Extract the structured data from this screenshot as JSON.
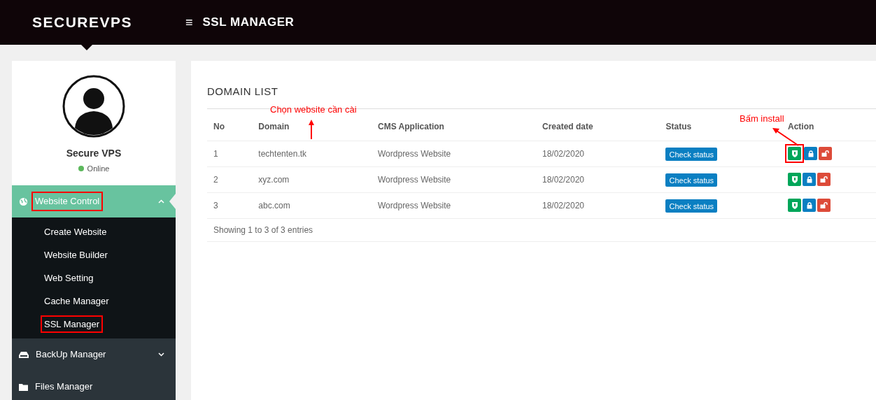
{
  "header": {
    "logo": "SECUREVPS",
    "menu_icon": "≡",
    "title": "SSL MANAGER"
  },
  "profile": {
    "name": "Secure VPS",
    "status": "Online",
    "online": true
  },
  "sidebar": {
    "items": [
      {
        "label": "Website Control",
        "expanded": true,
        "selected": true,
        "highlighted": true,
        "children": [
          {
            "label": "Create Website",
            "highlighted": false
          },
          {
            "label": "Website Builder",
            "highlighted": false
          },
          {
            "label": "Web Setting",
            "highlighted": false
          },
          {
            "label": "Cache Manager",
            "highlighted": false
          },
          {
            "label": "SSL Manager",
            "highlighted": true
          }
        ]
      },
      {
        "label": "BackUp Manager",
        "expanded": false,
        "selected": false,
        "highlighted": false
      },
      {
        "label": "Files Manager",
        "selected": false,
        "highlighted": false
      }
    ]
  },
  "panel": {
    "title": "DOMAIN LIST",
    "table": {
      "columns": [
        "No",
        "Domain",
        "CMS Application",
        "Created date",
        "Status",
        "Action"
      ],
      "rows": [
        {
          "no": "1",
          "domain": "techtenten.tk",
          "cms": "Wordpress Website",
          "created": "18/02/2020",
          "status": "Check status",
          "actions": [
            {
              "kind": "install",
              "highlighted": true
            },
            {
              "kind": "lock",
              "highlighted": false
            },
            {
              "kind": "unlock",
              "highlighted": false
            }
          ]
        },
        {
          "no": "2",
          "domain": "xyz.com",
          "cms": "Wordpress Website",
          "created": "18/02/2020",
          "status": "Check status",
          "actions": [
            {
              "kind": "install",
              "highlighted": false
            },
            {
              "kind": "lock",
              "highlighted": false
            },
            {
              "kind": "unlock",
              "highlighted": false
            }
          ]
        },
        {
          "no": "3",
          "domain": "abc.com",
          "cms": "Wordpress Website",
          "created": "18/02/2020",
          "status": "Check status",
          "actions": [
            {
              "kind": "install",
              "highlighted": false
            },
            {
              "kind": "lock",
              "highlighted": false
            },
            {
              "kind": "unlock",
              "highlighted": false
            }
          ]
        }
      ]
    },
    "footer": "Showing 1 to 3 of 3 entries"
  },
  "annotations": [
    {
      "kind": "domain",
      "text": "Chọn website cần cài"
    },
    {
      "kind": "install",
      "text": "Bấm install"
    }
  ]
}
